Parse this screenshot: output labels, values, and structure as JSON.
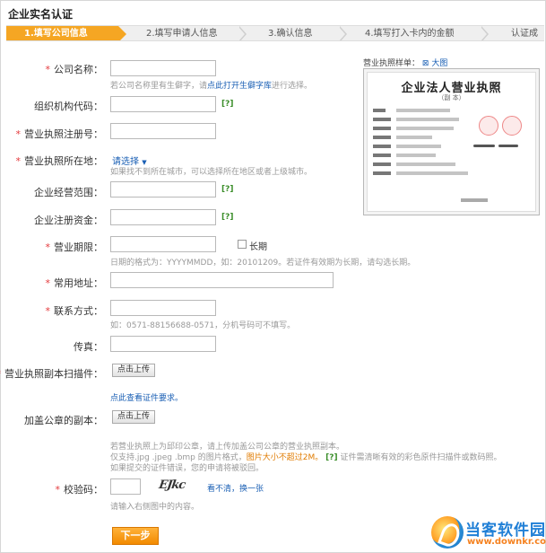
{
  "page": {
    "title": "企业实名认证"
  },
  "steps": [
    {
      "label": "1.填写公司信息",
      "active": true
    },
    {
      "label": "2.填写申请人信息",
      "active": false
    },
    {
      "label": "3.确认信息",
      "active": false
    },
    {
      "label": "4.填写打入卡内的金额",
      "active": false
    },
    {
      "label": "认证成功",
      "active": false
    }
  ],
  "form": {
    "company_name": {
      "label": "公司名称：",
      "required": true,
      "value": "",
      "hint_prefix": "若公司名称里有生僻字，请",
      "hint_link": "点此打开生僻字库",
      "hint_suffix": "进行选择。"
    },
    "org_code": {
      "label": "组织机构代码：",
      "required": false,
      "value": "",
      "help": "[?]"
    },
    "license_no": {
      "label": "营业执照注册号：",
      "required": true,
      "value": ""
    },
    "license_location": {
      "label": "营业执照所在地：",
      "required": true,
      "select_label": "请选择",
      "hint": "如果找不到所在城市，可以选择所在地区或者上级城市。"
    },
    "business_scope": {
      "label": "企业经营范围：",
      "required": false,
      "value": "",
      "help": "[?]"
    },
    "registered_capital": {
      "label": "企业注册资金：",
      "required": false,
      "value": "",
      "help": "[?]"
    },
    "business_term": {
      "label": "营业期限：",
      "required": true,
      "value": "",
      "long_term_label": "长期",
      "hint": "日期的格式为：YYYYMMDD，如：20101209。若证件有效期为长期，请勾选长期。"
    },
    "address": {
      "label": "常用地址：",
      "required": true,
      "value": ""
    },
    "contact": {
      "label": "联系方式：",
      "required": true,
      "value": "",
      "hint": "如：0571-88156688-0571，分机号码可不填写。"
    },
    "fax": {
      "label": "传真：",
      "required": false,
      "value": ""
    },
    "license_scan": {
      "label": "营业执照副本扫描件：",
      "required": true,
      "button": "点击上传",
      "link": "点此查看证件要求。"
    },
    "stamped_copy": {
      "label": "加盖公章的副本：",
      "required": false,
      "button": "点击上传",
      "hint_line1": "若营业执照上为邱印公章，请上传加盖公司公章的营业执照副本。",
      "hint_line2_prefix": "仅支持.jpg .jpeg .bmp 的图片格式，",
      "hint_line2_warn": "图片大小不超过2M。",
      "hint_line2_help": "[?]",
      "hint_line2_suffix": "证件需清晰有效的彩色原件扫描件或数码照。",
      "hint_line3": "如果提交的证件错误，您的申请将被驳回。"
    },
    "captcha": {
      "label": "校验码：",
      "required": true,
      "value": "",
      "image_text": "EJkc",
      "refresh": "看不清，换一张",
      "hint": "请输入右侧图中的内容。"
    },
    "next_button": "下一步"
  },
  "sample": {
    "heading": "营业执照样单：",
    "zoom_link": "大图",
    "doc_title": "企业法人营业执照",
    "doc_subtitle": "（副 本）"
  },
  "watermark": {
    "name": "当客软件园",
    "url": "www.downkr.com"
  },
  "colors": {
    "accent": "#f5a623",
    "required": "#e4393c",
    "link": "#1a5fb4",
    "help": "#3b8e2a",
    "warn": "#e07b00"
  }
}
